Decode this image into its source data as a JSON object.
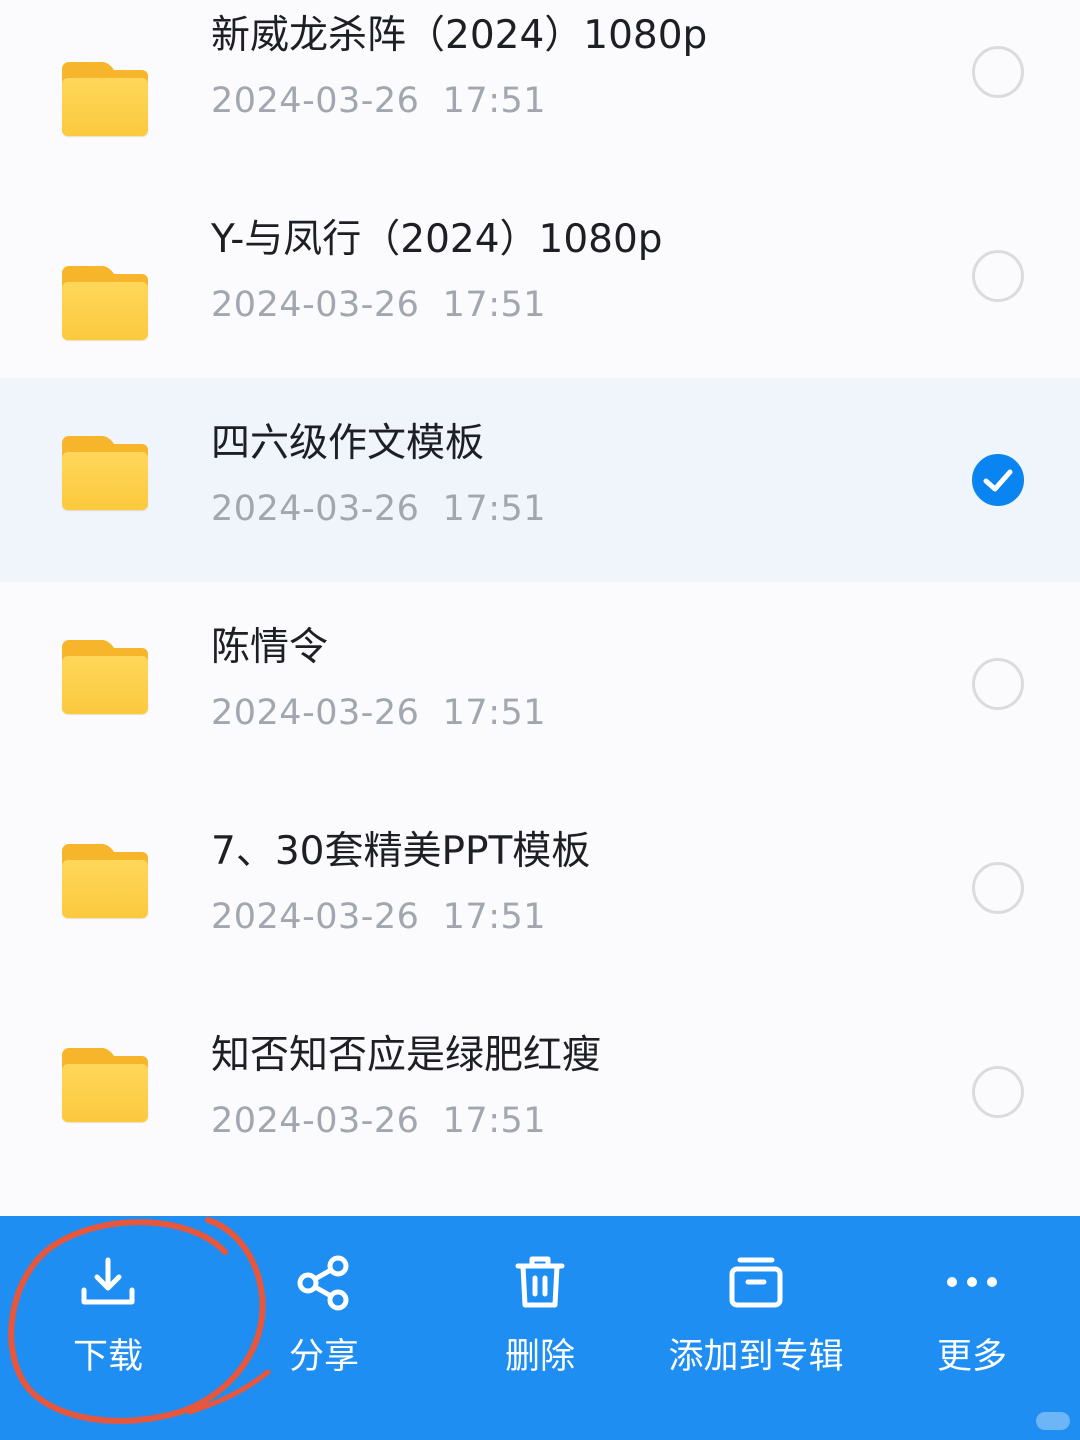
{
  "files": [
    {
      "name": "新威龙杀阵（2024）1080p",
      "date": "2024-03-26  17:51",
      "selected": false
    },
    {
      "name": "Y-与凤行（2024）1080p",
      "date": "2024-03-26  17:51",
      "selected": false
    },
    {
      "name": "四六级作文模板",
      "date": "2024-03-26  17:51",
      "selected": true
    },
    {
      "name": "陈情令",
      "date": "2024-03-26  17:51",
      "selected": false
    },
    {
      "name": "7、30套精美PPT模板",
      "date": "2024-03-26  17:51",
      "selected": false
    },
    {
      "name": "知否知否应是绿肥红瘦",
      "date": "2024-03-26  17:51",
      "selected": false
    }
  ],
  "action_bar": {
    "download_label": "下载",
    "share_label": "分享",
    "delete_label": "删除",
    "add_to_album_label": "添加到专辑",
    "more_label": "更多"
  },
  "icons": {
    "file": "folder-icon",
    "unchecked": "radio-unchecked-icon",
    "checked": "check-circle-icon",
    "download": "download-icon",
    "share": "share-icon",
    "delete": "trash-icon",
    "album": "album-icon",
    "more": "more-dots-icon"
  },
  "colors": {
    "accent": "#1e8ef2",
    "check": "#0a84f0",
    "selected_row": "#f0f4fb",
    "folder": "#fbc93e",
    "annotation": "#e8573c"
  }
}
